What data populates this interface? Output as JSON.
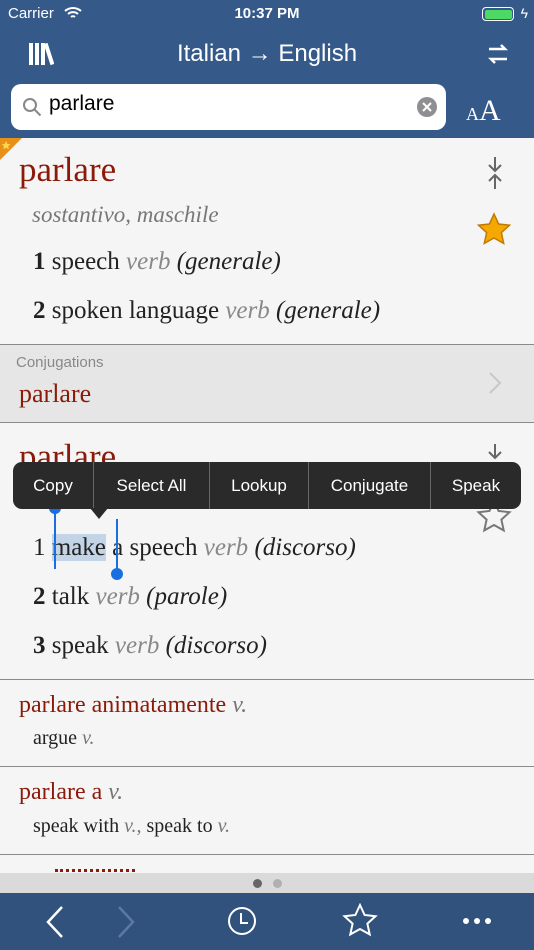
{
  "status": {
    "carrier": "Carrier",
    "time": "10:37 PM"
  },
  "nav": {
    "title": "Italian → English"
  },
  "search": {
    "value": "parlare",
    "font_small": "A",
    "font_large": "A"
  },
  "entry1": {
    "headword": "parlare",
    "pos": "sostantivo, maschile",
    "favorited": true,
    "senses": [
      {
        "num": "1",
        "text": "speech",
        "pos": "verb",
        "ctx": "(generale)"
      },
      {
        "num": "2",
        "text": "spoken language",
        "pos": "verb",
        "ctx": "(generale)"
      }
    ]
  },
  "conjugations": {
    "label": "Conjugations",
    "word": "parlare"
  },
  "entry2": {
    "headword": "parlare",
    "favorited": false,
    "selected": "make",
    "senses": [
      {
        "num": "1",
        "text": "a speech",
        "pos": "verb",
        "ctx": "(discorso)"
      },
      {
        "num": "2",
        "text": "talk",
        "pos": "verb",
        "ctx": "(parole)"
      },
      {
        "num": "3",
        "text": "speak",
        "pos": "verb",
        "ctx": "(discorso)"
      }
    ]
  },
  "context_menu": [
    "Copy",
    "Select All",
    "Lookup",
    "Conjugate",
    "Speak"
  ],
  "phrase1": {
    "headword": "parlare animatamente",
    "pos": "v.",
    "translation": "argue",
    "tpos": "v."
  },
  "phrase2": {
    "headword": "parlare a",
    "pos": "v.",
    "t1": "speak with",
    "t1pos": "v.,",
    "t2": "speak to",
    "t2pos": "v."
  },
  "pager": {
    "pages": 2,
    "current": 1
  },
  "colors": {
    "bar": "#355a8a",
    "tabbar": "#30527c",
    "headword": "#8b1a0a",
    "star": "#f5a800"
  }
}
